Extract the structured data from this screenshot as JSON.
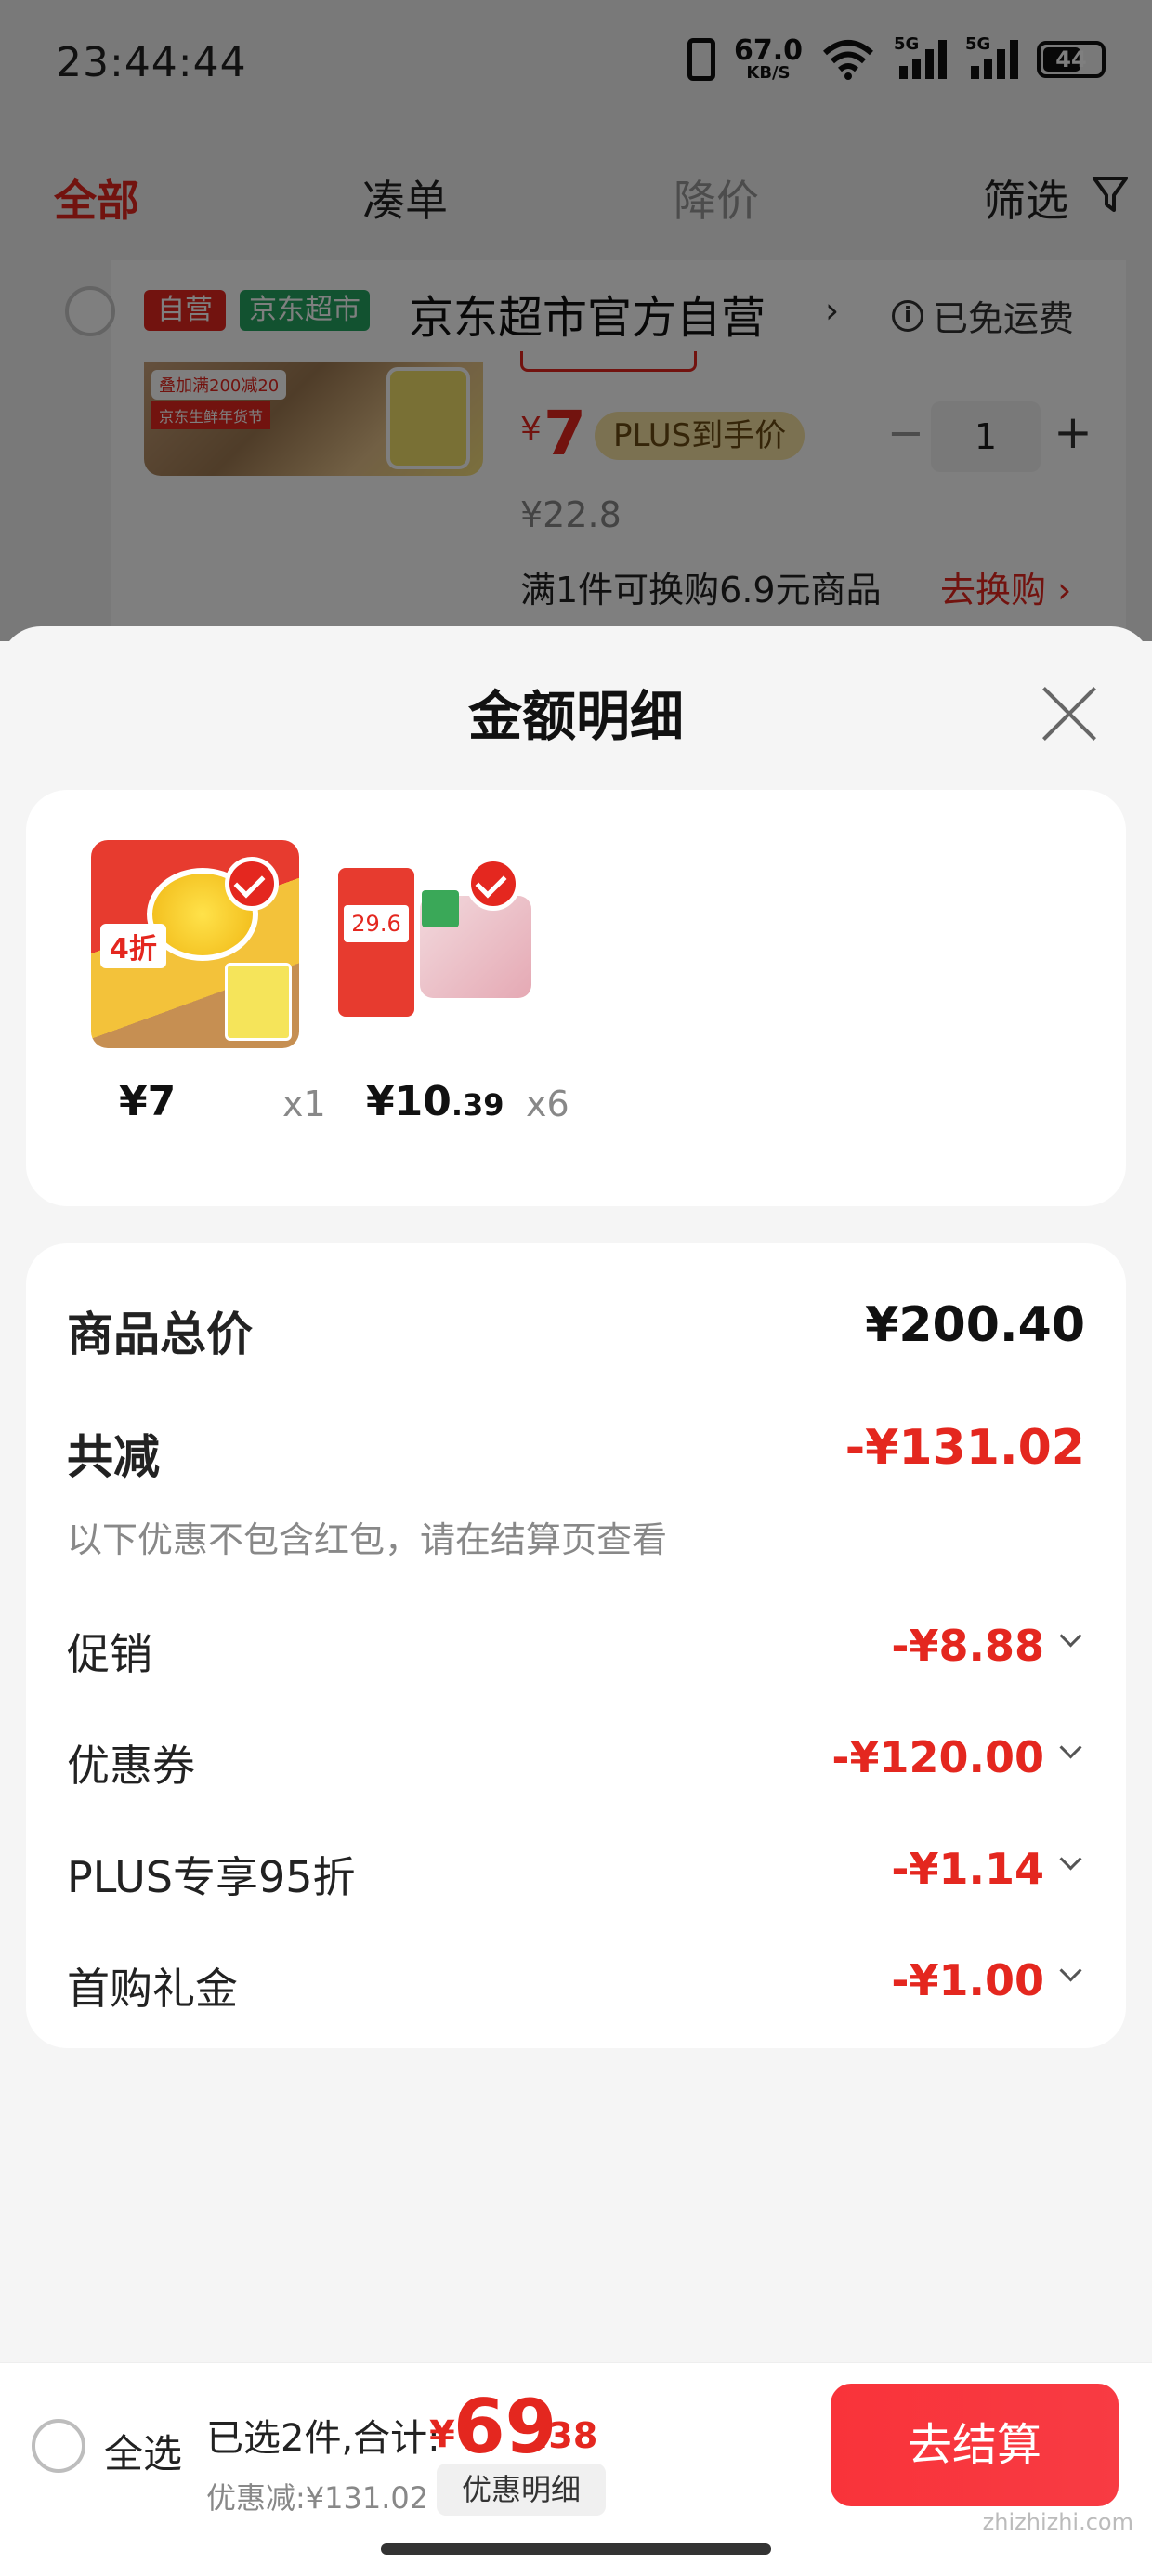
{
  "status_bar": {
    "time": "23:44:44",
    "speed_value": "67.0",
    "speed_unit": "KB/S",
    "signal1_label": "5G",
    "signal2_label": "5G",
    "battery": "44"
  },
  "tabs": [
    {
      "label": "全部"
    },
    {
      "label": "凑单"
    },
    {
      "label": "降价"
    },
    {
      "label": "筛选"
    }
  ],
  "shop": {
    "tag_self": "自营",
    "tag_market": "京东超市",
    "name": "京东超市官方自营",
    "chevron": "›",
    "free_shipping": "已免运费",
    "info_icon": "i"
  },
  "cart_item": {
    "thumb_badge1": "叠加满200减20",
    "thumb_badge2": "京东生鲜年货节",
    "price_symbol": "¥",
    "price": "7",
    "plus_tag": "PLUS到手价",
    "qty": "1",
    "minus": "−",
    "plus": "+",
    "original_price": "¥22.8",
    "exchange_text": "满1件可换购6.9元商品",
    "exchange_link": "去换购 ›"
  },
  "sheet": {
    "title": "金额明细",
    "items": [
      {
        "img_label": "4折",
        "price_int": "¥7",
        "price_dec": "",
        "qty": "x1"
      },
      {
        "img_label": "29.6",
        "price_int": "¥10",
        "price_dec": ".39",
        "qty": "x6"
      }
    ],
    "summary": {
      "subtotal_label": "商品总价",
      "subtotal_value": "¥200.40",
      "total_reduce_label": "共减",
      "total_reduce_value": "-¥131.02",
      "note": "以下优惠不包含红包，请在结算页查看",
      "lines": [
        {
          "label": "促销",
          "value": "-¥8.88"
        },
        {
          "label": "优惠券",
          "value": "-¥120.00"
        },
        {
          "label": "PLUS专享95折",
          "value": "-¥1.14"
        },
        {
          "label": "首购礼金",
          "value": "-¥1.00"
        }
      ]
    }
  },
  "bottom_bar": {
    "select_all": "全选",
    "selected_text": "已选2件,合计:",
    "total_symbol": "¥",
    "total_int": "69",
    "total_dec": ".38",
    "discount_text": "优惠减:¥131.02",
    "detail_button": "优惠明细",
    "checkout_button": "去结算"
  },
  "watermark": "zhizhizhi.com",
  "colors": {
    "accent": "#e4271f",
    "plus_bg": "#f6e2a2",
    "market_green": "#24a560"
  }
}
